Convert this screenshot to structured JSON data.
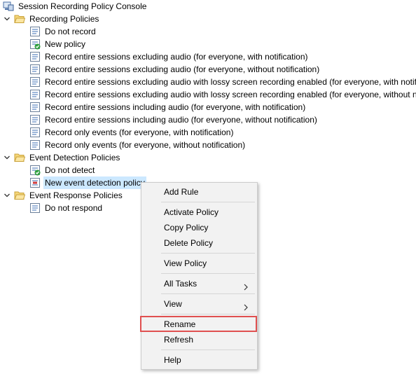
{
  "console_title": "Session Recording Policy Console",
  "tree": {
    "recording_policies": {
      "label": "Recording Policies",
      "items": [
        "Do not record",
        "New policy",
        "Record entire sessions excluding audio (for everyone, with notification)",
        "Record entire sessions excluding audio (for everyone, without notification)",
        "Record entire sessions excluding audio with lossy screen recording enabled (for everyone, with notific",
        "Record entire sessions excluding audio with lossy screen recording enabled (for everyone, without no",
        "Record entire sessions including audio (for everyone, with notification)",
        "Record entire sessions including audio (for everyone, without notification)",
        "Record only events (for everyone, with notification)",
        "Record only events (for everyone, without notification)"
      ]
    },
    "event_detection_policies": {
      "label": "Event Detection Policies",
      "items": [
        "Do not detect",
        "New event detection policy"
      ]
    },
    "event_response_policies": {
      "label": "Event Response Policies",
      "items": [
        "Do not respond"
      ]
    }
  },
  "context_menu": {
    "add_rule": "Add Rule",
    "activate_policy": "Activate Policy",
    "copy_policy": "Copy Policy",
    "delete_policy": "Delete Policy",
    "view_policy": "View Policy",
    "all_tasks": "All Tasks",
    "view": "View",
    "rename": "Rename",
    "refresh": "Refresh",
    "help": "Help"
  },
  "colors": {
    "selection": "#cce8ff",
    "highlight_border": "#e05050",
    "menu_bg": "#f2f2f2"
  }
}
